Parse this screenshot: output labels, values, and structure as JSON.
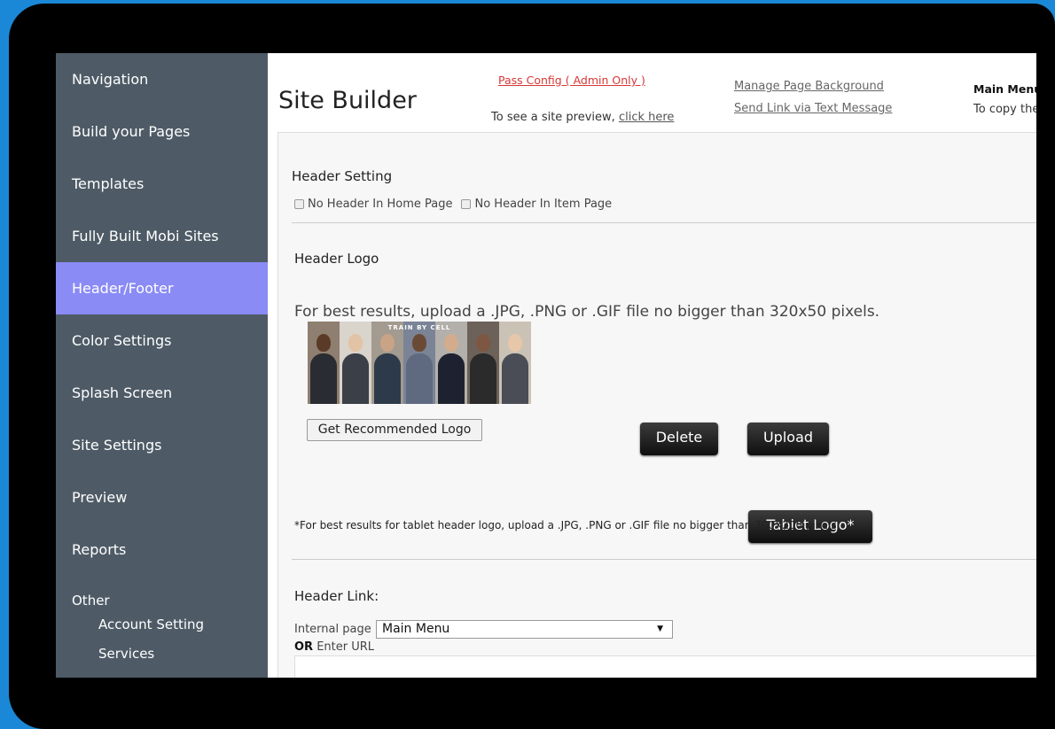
{
  "sidebar": {
    "items": [
      {
        "label": "Navigation",
        "active": false
      },
      {
        "label": "Build your Pages",
        "active": false
      },
      {
        "label": "Templates",
        "active": false
      },
      {
        "label": "Fully Built Mobi Sites",
        "active": false
      },
      {
        "label": "Header/Footer",
        "active": true
      },
      {
        "label": "Color Settings",
        "active": false
      },
      {
        "label": "Splash Screen",
        "active": false
      },
      {
        "label": "Site Settings",
        "active": false
      },
      {
        "label": "Preview",
        "active": false
      },
      {
        "label": "Reports",
        "active": false
      }
    ],
    "other_heading": "Other",
    "other_items": [
      "Account Setting",
      "Services"
    ],
    "active_color": "#8a8bf5",
    "background_color": "#4e5b66"
  },
  "header": {
    "title": "Site Builder",
    "pass_config": "Pass Config ( Admin Only )",
    "preview_text": "To see a site preview,",
    "preview_link": "click here",
    "manage_bg_link": "Manage Page Background",
    "send_link": "Send Link via Text Message",
    "main_menu_label": "Main Menu",
    "copy_text": "To copy the"
  },
  "header_setting": {
    "title": "Header Setting",
    "no_header_home": "No Header In Home Page",
    "no_header_item": "No Header In Item Page"
  },
  "header_logo": {
    "title": "Header Logo",
    "hint": "For best results, upload a .JPG, .PNG or .GIF file no bigger than 320x50 pixels.",
    "image_text": "TRAIN BY CELL",
    "delete_label": "Delete",
    "upload_label": "Upload",
    "recommended_label": "Get Recommended Logo",
    "tablet_logo_label": "Tablet Logo*",
    "tablet_note": "*For best results for tablet header logo, upload a .JPG, .PNG or .GIF file no bigger than 700X200 pixels."
  },
  "header_link": {
    "title": "Header Link:",
    "internal_label": "Internal page",
    "selected_page": "Main Menu",
    "or_label": "OR",
    "enter_url_label": "Enter URL"
  }
}
